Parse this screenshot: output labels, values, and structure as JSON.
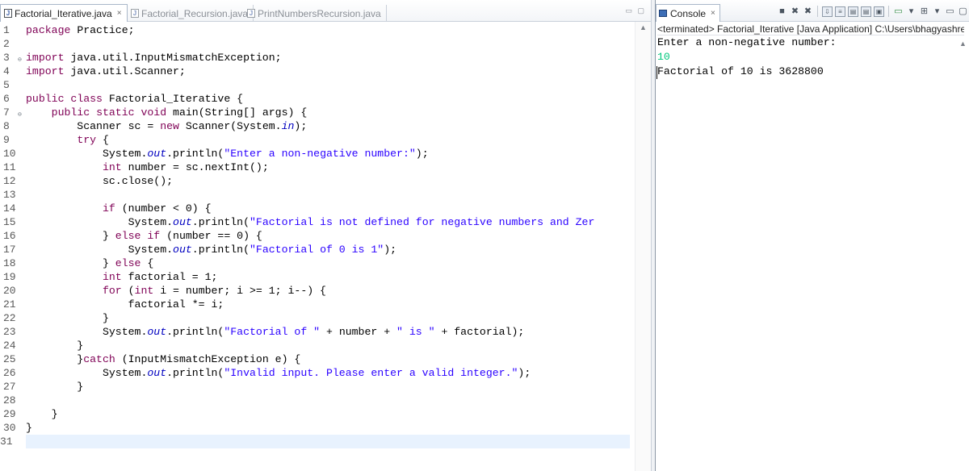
{
  "editor": {
    "tabs": [
      {
        "label": "Factorial_Iterative.java",
        "close": "×",
        "active": true
      },
      {
        "label": "Factorial_Recursion.java",
        "active": false
      },
      {
        "label": "PrintNumbersRecursion.java",
        "active": false
      }
    ],
    "lines": [
      {
        "n": "1",
        "html": "<span class=\"k\">package</span> Practice;"
      },
      {
        "n": "2",
        "html": ""
      },
      {
        "n": "3",
        "fold": true,
        "html": "<span class=\"k\">import</span> java.util.InputMismatchException;"
      },
      {
        "n": "4",
        "html": "<span class=\"k\">import</span> java.util.Scanner;"
      },
      {
        "n": "5",
        "html": ""
      },
      {
        "n": "6",
        "html": "<span class=\"k\">public</span> <span class=\"k\">class</span> Factorial_Iterative {"
      },
      {
        "n": "7",
        "fold": true,
        "html": "    <span class=\"k\">public</span> <span class=\"k\">static</span> <span class=\"k\">void</span> main(String[] args) {"
      },
      {
        "n": "8",
        "html": "        Scanner sc = <span class=\"k\">new</span> Scanner(System.<span class=\"f\">in</span>);"
      },
      {
        "n": "9",
        "html": "        <span class=\"k\">try</span> {"
      },
      {
        "n": "10",
        "html": "            System.<span class=\"f\">out</span>.println(<span class=\"s\">\"Enter a non-negative number:\"</span>);"
      },
      {
        "n": "11",
        "html": "            <span class=\"k\">int</span> number = sc.nextInt();"
      },
      {
        "n": "12",
        "html": "            sc.close();"
      },
      {
        "n": "13",
        "html": ""
      },
      {
        "n": "14",
        "html": "            <span class=\"k\">if</span> (number &lt; 0) {"
      },
      {
        "n": "15",
        "html": "                System.<span class=\"f\">out</span>.println(<span class=\"s\">\"Factorial is not defined for negative numbers and Zer</span>"
      },
      {
        "n": "16",
        "html": "            } <span class=\"k\">else</span> <span class=\"k\">if</span> (number == 0) {"
      },
      {
        "n": "17",
        "html": "                System.<span class=\"f\">out</span>.println(<span class=\"s\">\"Factorial of 0 is 1\"</span>);"
      },
      {
        "n": "18",
        "html": "            } <span class=\"k\">else</span> {"
      },
      {
        "n": "19",
        "html": "            <span class=\"k\">int</span> factorial = 1;"
      },
      {
        "n": "20",
        "html": "            <span class=\"k\">for</span> (<span class=\"k\">int</span> i = number; i &gt;= 1; i--) {"
      },
      {
        "n": "21",
        "html": "                factorial *= i;"
      },
      {
        "n": "22",
        "html": "            }"
      },
      {
        "n": "23",
        "html": "            System.<span class=\"f\">out</span>.println(<span class=\"s\">\"Factorial of \"</span> + number + <span class=\"s\">\" is \"</span> + factorial);"
      },
      {
        "n": "24",
        "html": "        }"
      },
      {
        "n": "25",
        "html": "        }<span class=\"k\">catch</span> (InputMismatchException e) {"
      },
      {
        "n": "26",
        "html": "            System.<span class=\"f\">out</span>.println(<span class=\"s\">\"Invalid input. Please enter a valid integer.\"</span>);"
      },
      {
        "n": "27",
        "html": "        }"
      },
      {
        "n": "28",
        "html": ""
      },
      {
        "n": "29",
        "html": "    }"
      },
      {
        "n": "30",
        "html": "}"
      },
      {
        "n": "31",
        "html": "",
        "current": true
      }
    ]
  },
  "console": {
    "tab_label": "Console",
    "tab_close": "×",
    "status": "<terminated> Factorial_Iterative [Java Application] C:\\Users\\bhagyashree\\.p",
    "prompt": "Enter a non-negative number:",
    "input": "10",
    "result": "Factorial of 10 is 3628800"
  },
  "colors": {
    "keyword": "#7f0055",
    "string": "#2a00ff",
    "static_field": "#0000c0",
    "console_input": "#00c87d",
    "current_line": "#e8f2fe"
  }
}
